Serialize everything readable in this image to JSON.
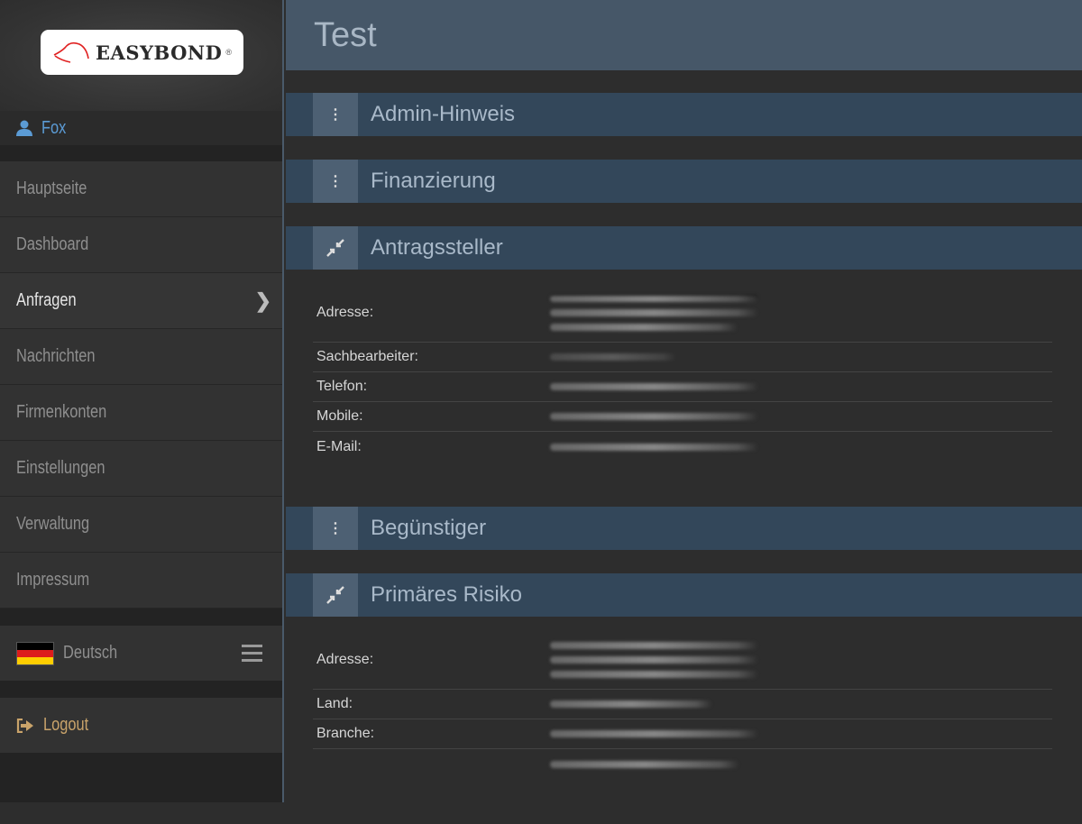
{
  "logo": {
    "text": "EASYBOND",
    "mark": "®"
  },
  "user": {
    "name": "Fox"
  },
  "menu": [
    {
      "label": "Hauptseite"
    },
    {
      "label": "Dashboard"
    },
    {
      "label": "Anfragen",
      "active": true
    },
    {
      "label": "Nachrichten"
    },
    {
      "label": "Firmenkonten"
    },
    {
      "label": "Einstellungen"
    },
    {
      "label": "Verwaltung"
    },
    {
      "label": "Impressum"
    }
  ],
  "language": {
    "label": "Deutsch"
  },
  "logout": {
    "label": "Logout"
  },
  "page": {
    "title": "Test"
  },
  "sections": {
    "admin": {
      "title": "Admin-Hinweis"
    },
    "finanz": {
      "title": "Finanzierung"
    },
    "antrag": {
      "title": "Antragssteller",
      "labels": {
        "adresse": "Adresse:",
        "sach": "Sachbearbeiter:",
        "tel": "Telefon:",
        "mobile": "Mobile:",
        "email": "E-Mail:"
      }
    },
    "beg": {
      "title": "Begünstiger"
    },
    "risiko": {
      "title": "Primäres Risiko",
      "labels": {
        "adresse": "Adresse:",
        "land": "Land:",
        "branche": "Branche:"
      }
    }
  }
}
